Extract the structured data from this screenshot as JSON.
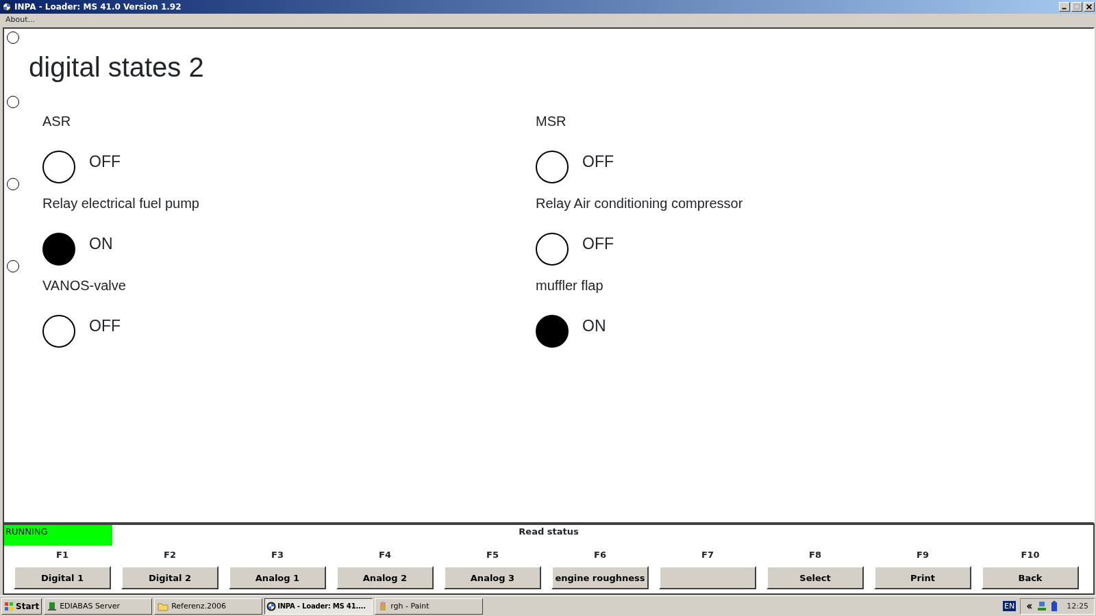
{
  "window": {
    "title": "INPA - Loader: MS 41.0 Version 1.92"
  },
  "menu": [
    "About..."
  ],
  "screen_title": "digital states 2",
  "side_options": [
    {
      "selected": false
    },
    {
      "selected": false
    },
    {
      "selected": false
    },
    {
      "selected": false
    }
  ],
  "signals": [
    {
      "label": "ASR",
      "on": false,
      "state": "OFF"
    },
    {
      "label": "MSR",
      "on": false,
      "state": "OFF"
    },
    {
      "label": "Relay electrical fuel pump",
      "on": true,
      "state": "ON"
    },
    {
      "label": "Relay Air conditioning compressor",
      "on": false,
      "state": "OFF"
    },
    {
      "label": "VANOS-valve",
      "on": false,
      "state": "OFF"
    },
    {
      "label": "muffler flap",
      "on": true,
      "state": "ON"
    }
  ],
  "status": {
    "state": "RUNNING",
    "message": "Read status"
  },
  "function_keys": [
    {
      "key": "F1",
      "label": "Digital 1"
    },
    {
      "key": "F2",
      "label": "Digital 2"
    },
    {
      "key": "F3",
      "label": "Analog 1"
    },
    {
      "key": "F4",
      "label": "Analog 2"
    },
    {
      "key": "F5",
      "label": "Analog 3"
    },
    {
      "key": "F6",
      "label": "engine roughness"
    },
    {
      "key": "F7"
    },
    {
      "key": "F8",
      "label": "Select"
    },
    {
      "key": "F9",
      "label": "Print"
    },
    {
      "key": "F10",
      "label": "Back"
    }
  ],
  "taskbar": {
    "start": "Start",
    "tasks": [
      {
        "label": "EDIABAS Server",
        "kind": "server",
        "selected": false
      },
      {
        "label": "Referenz.2006",
        "kind": "folder",
        "selected": false
      },
      {
        "label": "INPA - Loader:  MS 41....",
        "kind": "app",
        "selected": true
      },
      {
        "label": "rgh - Paint",
        "kind": "paint",
        "selected": false
      }
    ],
    "language": "EN",
    "clock": "12:25"
  }
}
